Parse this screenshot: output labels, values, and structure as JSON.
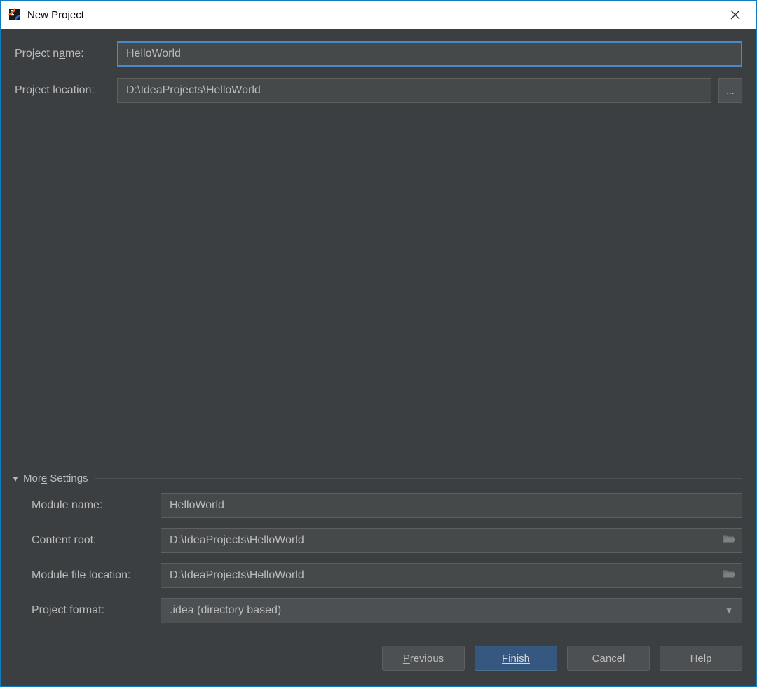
{
  "window": {
    "title": "New Project"
  },
  "fields": {
    "projectName": {
      "label": "Project name:",
      "value": "HelloWorld"
    },
    "projectLocation": {
      "label": "Project location:",
      "value": "D:\\IdeaProjects\\HelloWorld",
      "browse": "..."
    }
  },
  "moreSettings": {
    "header": "More Settings",
    "moduleName": {
      "label": "Module name:",
      "value": "HelloWorld"
    },
    "contentRoot": {
      "label": "Content root:",
      "value": "D:\\IdeaProjects\\HelloWorld"
    },
    "moduleFileLocation": {
      "label": "Module file location:",
      "value": "D:\\IdeaProjects\\HelloWorld"
    },
    "projectFormat": {
      "label": "Project format:",
      "value": ".idea (directory based)"
    }
  },
  "buttons": {
    "previous": "Previous",
    "finish": "Finish",
    "cancel": "Cancel",
    "help": "Help"
  }
}
